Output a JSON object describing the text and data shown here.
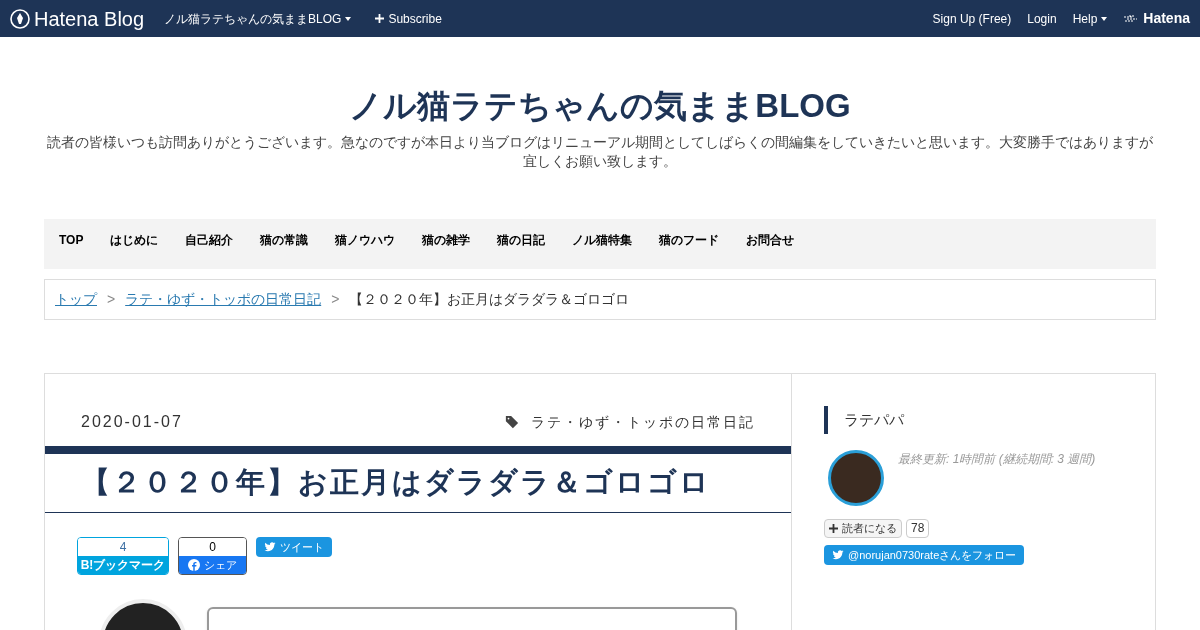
{
  "header": {
    "logo": "Hatena Blog",
    "blog_menu": "ノル猫ラテちゃんの気ままBLOG",
    "subscribe": "Subscribe",
    "links": [
      "Sign Up (Free)",
      "Login"
    ],
    "help": "Help",
    "brand": "Hatena"
  },
  "blog": {
    "title": "ノル猫ラテちゃんの気ままBLOG",
    "description": "読者の皆様いつも訪問ありがとうございます。急なのですが本日より当ブログはリニューアル期間としてしばらくの間編集をしていきたいと思います。大変勝手ではありますが宜しくお願い致します。"
  },
  "nav": [
    "TOP",
    "はじめに",
    "自己紹介",
    "猫の常識",
    "猫ノウハウ",
    "猫の雑学",
    "猫の日記",
    "ノル猫特集",
    "猫のフード",
    "お問合せ"
  ],
  "breadcrumb": {
    "links": [
      "トップ",
      "ラテ・ゆず・トッポの日常日記"
    ],
    "separator": ">",
    "current": "【２０２０年】お正月はダラダラ＆ゴロゴロ"
  },
  "article": {
    "date": "2020-01-07",
    "category": "ラテ・ゆず・トッポの日常日記",
    "title": "【２０２０年】お正月はダラダラ＆ゴロゴロ",
    "share": [
      {
        "kind": "hatena",
        "count": "4",
        "label": "ブックマーク",
        "mark": "B!"
      },
      {
        "kind": "facebook",
        "count": "0",
        "label": "シェア"
      },
      {
        "kind": "twitter",
        "label": "ツイート"
      }
    ]
  },
  "sidebar": {
    "heading": "ラテパパ",
    "updated": "最終更新: 1時間前 (継続期間: 3 週間)",
    "subscribe": "読者になる",
    "readers": "78",
    "follow": "@norujan0730rateさんをフォロー"
  }
}
